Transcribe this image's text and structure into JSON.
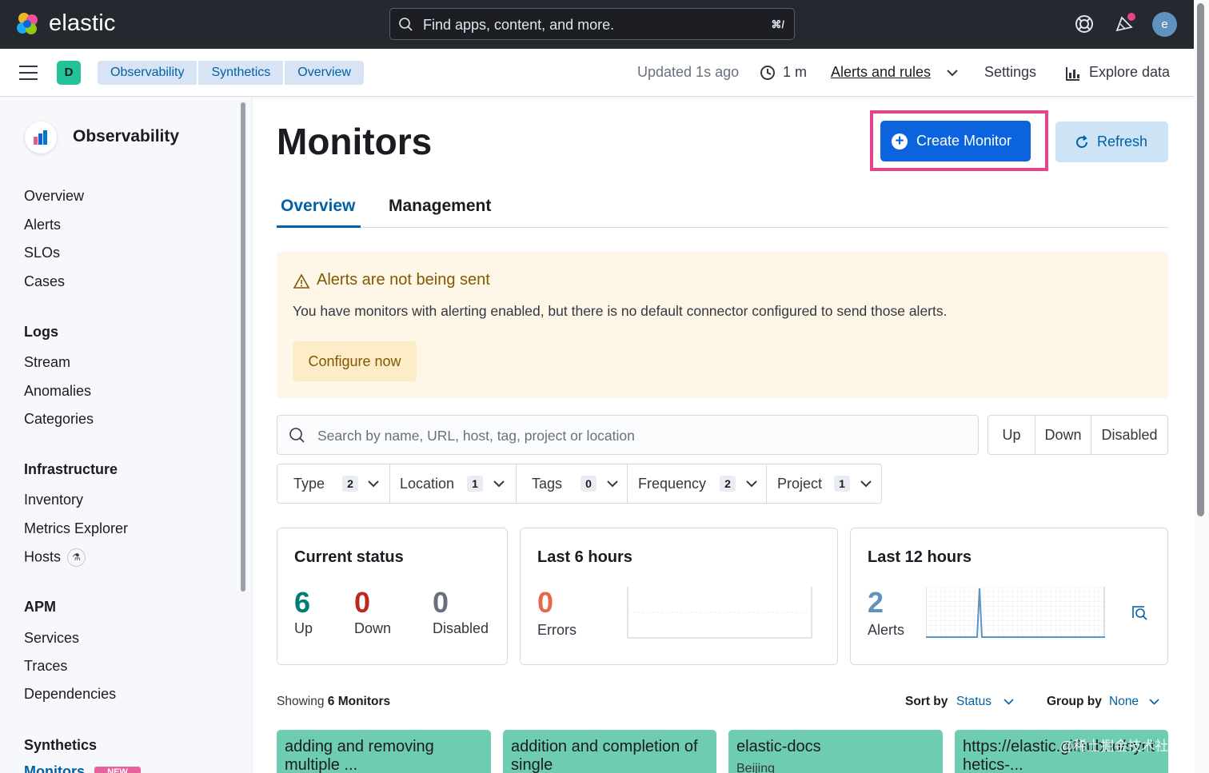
{
  "header": {
    "brand": "elastic",
    "search_placeholder": "Find apps, content, and more.",
    "search_shortcut": "⌘/",
    "avatar_initial": "e"
  },
  "subbar": {
    "space_initial": "D",
    "breadcrumbs": [
      "Observability",
      "Synthetics",
      "Overview"
    ],
    "updated": "Updated 1s ago",
    "interval": "1 m",
    "alerts_rules": "Alerts and rules",
    "settings": "Settings",
    "explore": "Explore data"
  },
  "sidebar": {
    "title": "Observability",
    "top_items": [
      "Overview",
      "Alerts",
      "SLOs",
      "Cases"
    ],
    "groups": [
      {
        "label": "Logs",
        "items": [
          "Stream",
          "Anomalies",
          "Categories"
        ]
      },
      {
        "label": "Infrastructure",
        "items": [
          "Inventory",
          "Metrics Explorer",
          "Hosts"
        ]
      },
      {
        "label": "APM",
        "items": [
          "Services",
          "Traces",
          "Dependencies"
        ]
      },
      {
        "label": "Synthetics",
        "items": [
          "Monitors"
        ]
      }
    ],
    "new_badge": "NEW"
  },
  "main": {
    "title": "Monitors",
    "create_button": "Create Monitor",
    "refresh_button": "Refresh",
    "tabs": [
      "Overview",
      "Management"
    ],
    "callout": {
      "title": "Alerts are not being sent",
      "body": "You have monitors with alerting enabled, but there is no default connector configured to send those alerts.",
      "button": "Configure now"
    },
    "search_placeholder": "Search by name, URL, host, tag, project or location",
    "status_buttons": [
      "Up",
      "Down",
      "Disabled"
    ],
    "filters": [
      {
        "label": "Type",
        "count": "2"
      },
      {
        "label": "Location",
        "count": "1"
      },
      {
        "label": "Tags",
        "count": "0"
      },
      {
        "label": "Frequency",
        "count": "2"
      },
      {
        "label": "Project",
        "count": "1"
      }
    ],
    "cards": {
      "current": {
        "title": "Current status",
        "up": "6",
        "up_label": "Up",
        "down": "0",
        "down_label": "Down",
        "disabled": "0",
        "disabled_label": "Disabled"
      },
      "last6": {
        "title": "Last 6 hours",
        "errors": "0",
        "errors_label": "Errors"
      },
      "last12": {
        "title": "Last 12 hours",
        "alerts": "2",
        "alerts_label": "Alerts"
      }
    },
    "showing_prefix": "Showing",
    "showing_count": "6 Monitors",
    "sort_label": "Sort by",
    "sort_value": "Status",
    "group_label": "Group by",
    "group_value": "None",
    "monitor_cards": [
      {
        "name": "adding and removing multiple ..."
      },
      {
        "name": "addition and completion of single"
      },
      {
        "name": "elastic-docs",
        "location": "Beijing"
      },
      {
        "name": "https://elastic.github.io/synthetics-..."
      }
    ],
    "watermark": "@稀土掘金技术社区"
  },
  "colors": {
    "accent": "#0b64dd",
    "up": "#017d73",
    "down": "#bd271e",
    "errors": "#e7664c",
    "alerts": "#6092c0",
    "highlight": "#e6438a",
    "monitor_up": "#6dccb1"
  }
}
